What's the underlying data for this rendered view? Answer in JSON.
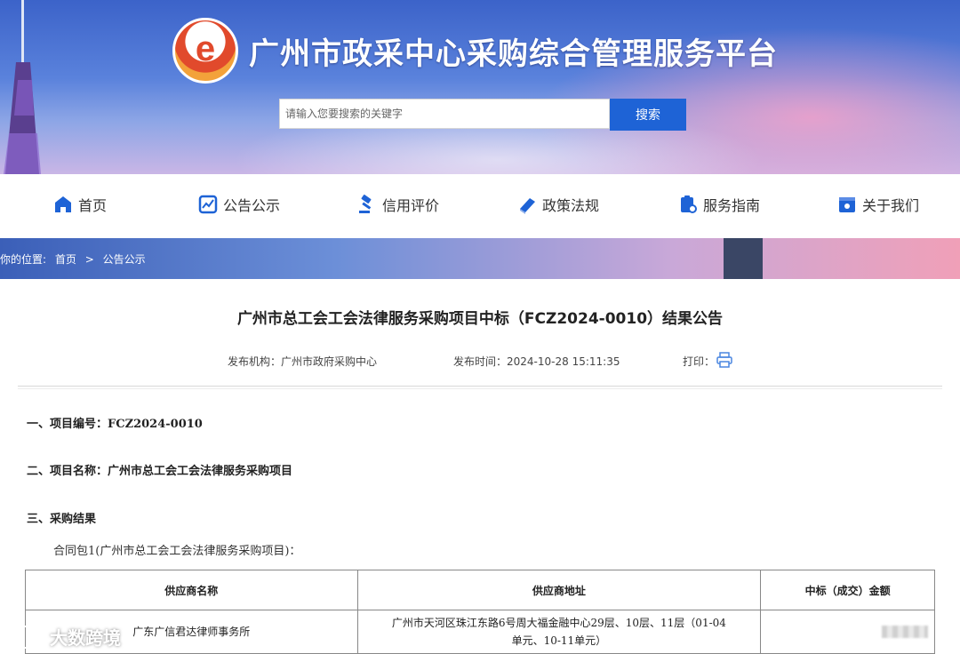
{
  "header": {
    "logo_letter": "e",
    "site_title": "广州市政采中心采购综合管理服务平台",
    "search_placeholder": "请输入您要搜索的关键字",
    "search_button": "搜索"
  },
  "nav": {
    "items": [
      {
        "label": "首页",
        "icon": "home-icon"
      },
      {
        "label": "公告公示",
        "icon": "chart-board-icon"
      },
      {
        "label": "信用评价",
        "icon": "gavel-icon"
      },
      {
        "label": "政策法规",
        "icon": "book-icon"
      },
      {
        "label": "服务指南",
        "icon": "guide-icon"
      },
      {
        "label": "关于我们",
        "icon": "about-icon"
      }
    ]
  },
  "breadcrumb": {
    "prefix": "你的位置:",
    "home": "首页",
    "sep": ">",
    "current": "公告公示"
  },
  "article": {
    "title": "广州市总工会工会法律服务采购项目中标（FCZ2024-0010）结果公告",
    "publisher_label": "发布机构：",
    "publisher": "广州市政府采购中心",
    "time_label": "发布时间：",
    "time": "2024-10-28 15:11:35",
    "print_label": "打印：",
    "sections": [
      "一、项目编号：FCZ2024-0010",
      "二、项目名称：广州市总工会工会法律服务采购项目",
      "三、采购结果"
    ],
    "package_label": "合同包1(广州市总工会工会法律服务采购项目)：",
    "table": {
      "headers": [
        "供应商名称",
        "供应商地址",
        "中标（成交）金额"
      ],
      "rows": [
        {
          "name": "广东广信君达律师事务所",
          "address_line1": "广州市天河区珠江东路6号周大福金融中心29层、10层、11层（01-04",
          "address_line2": "单元、10-11单元）",
          "amount": ""
        }
      ]
    }
  },
  "watermark": "大数跨境",
  "colors": {
    "primary_blue": "#1e63d6",
    "nav_icon_blue": "#1e63d6"
  }
}
